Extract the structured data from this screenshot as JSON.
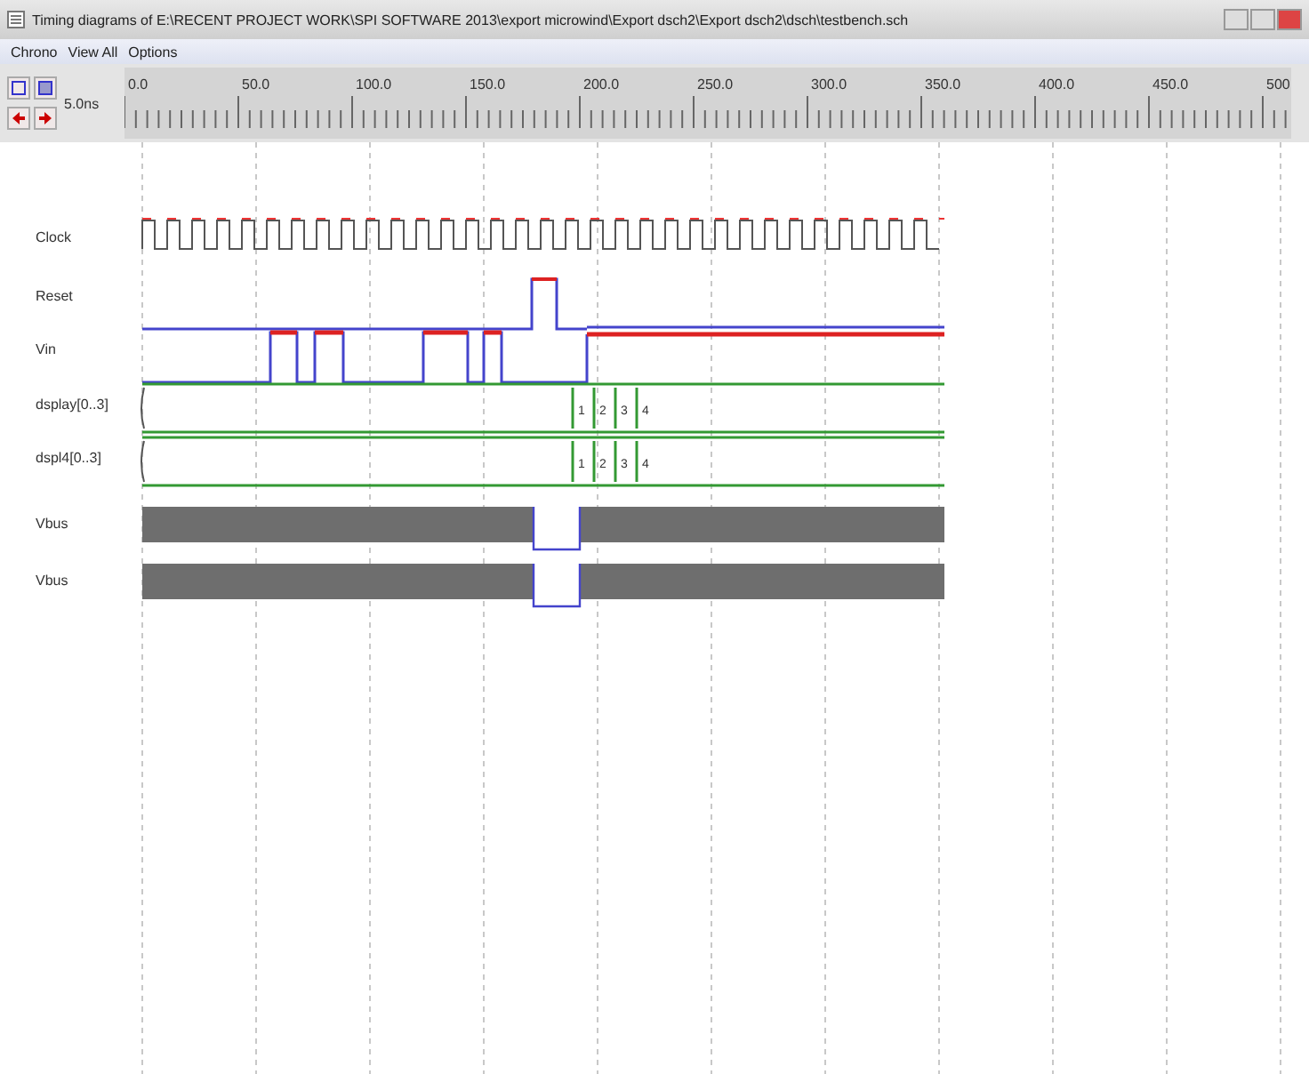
{
  "window": {
    "title": "Timing diagrams of E:\\RECENT PROJECT WORK\\SPI SOFTWARE 2013\\export microwind\\Export dsch2\\Export dsch2\\dsch\\testbench.sch"
  },
  "menu": [
    "Chrono",
    "View All",
    "Options"
  ],
  "toolbar": {
    "scale_label": "5.0ns"
  },
  "ruler": {
    "labels": [
      "0.0",
      "50.0",
      "100.0",
      "150.0",
      "200.0",
      "250.0",
      "300.0",
      "350.0",
      "400.0",
      "450.0",
      "500"
    ]
  },
  "signals": [
    {
      "name": "Clock",
      "kind": "clock"
    },
    {
      "name": "Reset",
      "kind": "reset"
    },
    {
      "name": "Vin",
      "kind": "input"
    },
    {
      "name": "dsplay[0..3]",
      "kind": "bus",
      "values": [
        "1",
        "2",
        "3",
        "4"
      ]
    },
    {
      "name": "dspl4[0..3]",
      "kind": "bus",
      "values": [
        "1",
        "2",
        "3",
        "4"
      ]
    },
    {
      "name": "Vbus",
      "kind": "analog"
    },
    {
      "name": "Vbus",
      "kind": "analog"
    }
  ]
}
